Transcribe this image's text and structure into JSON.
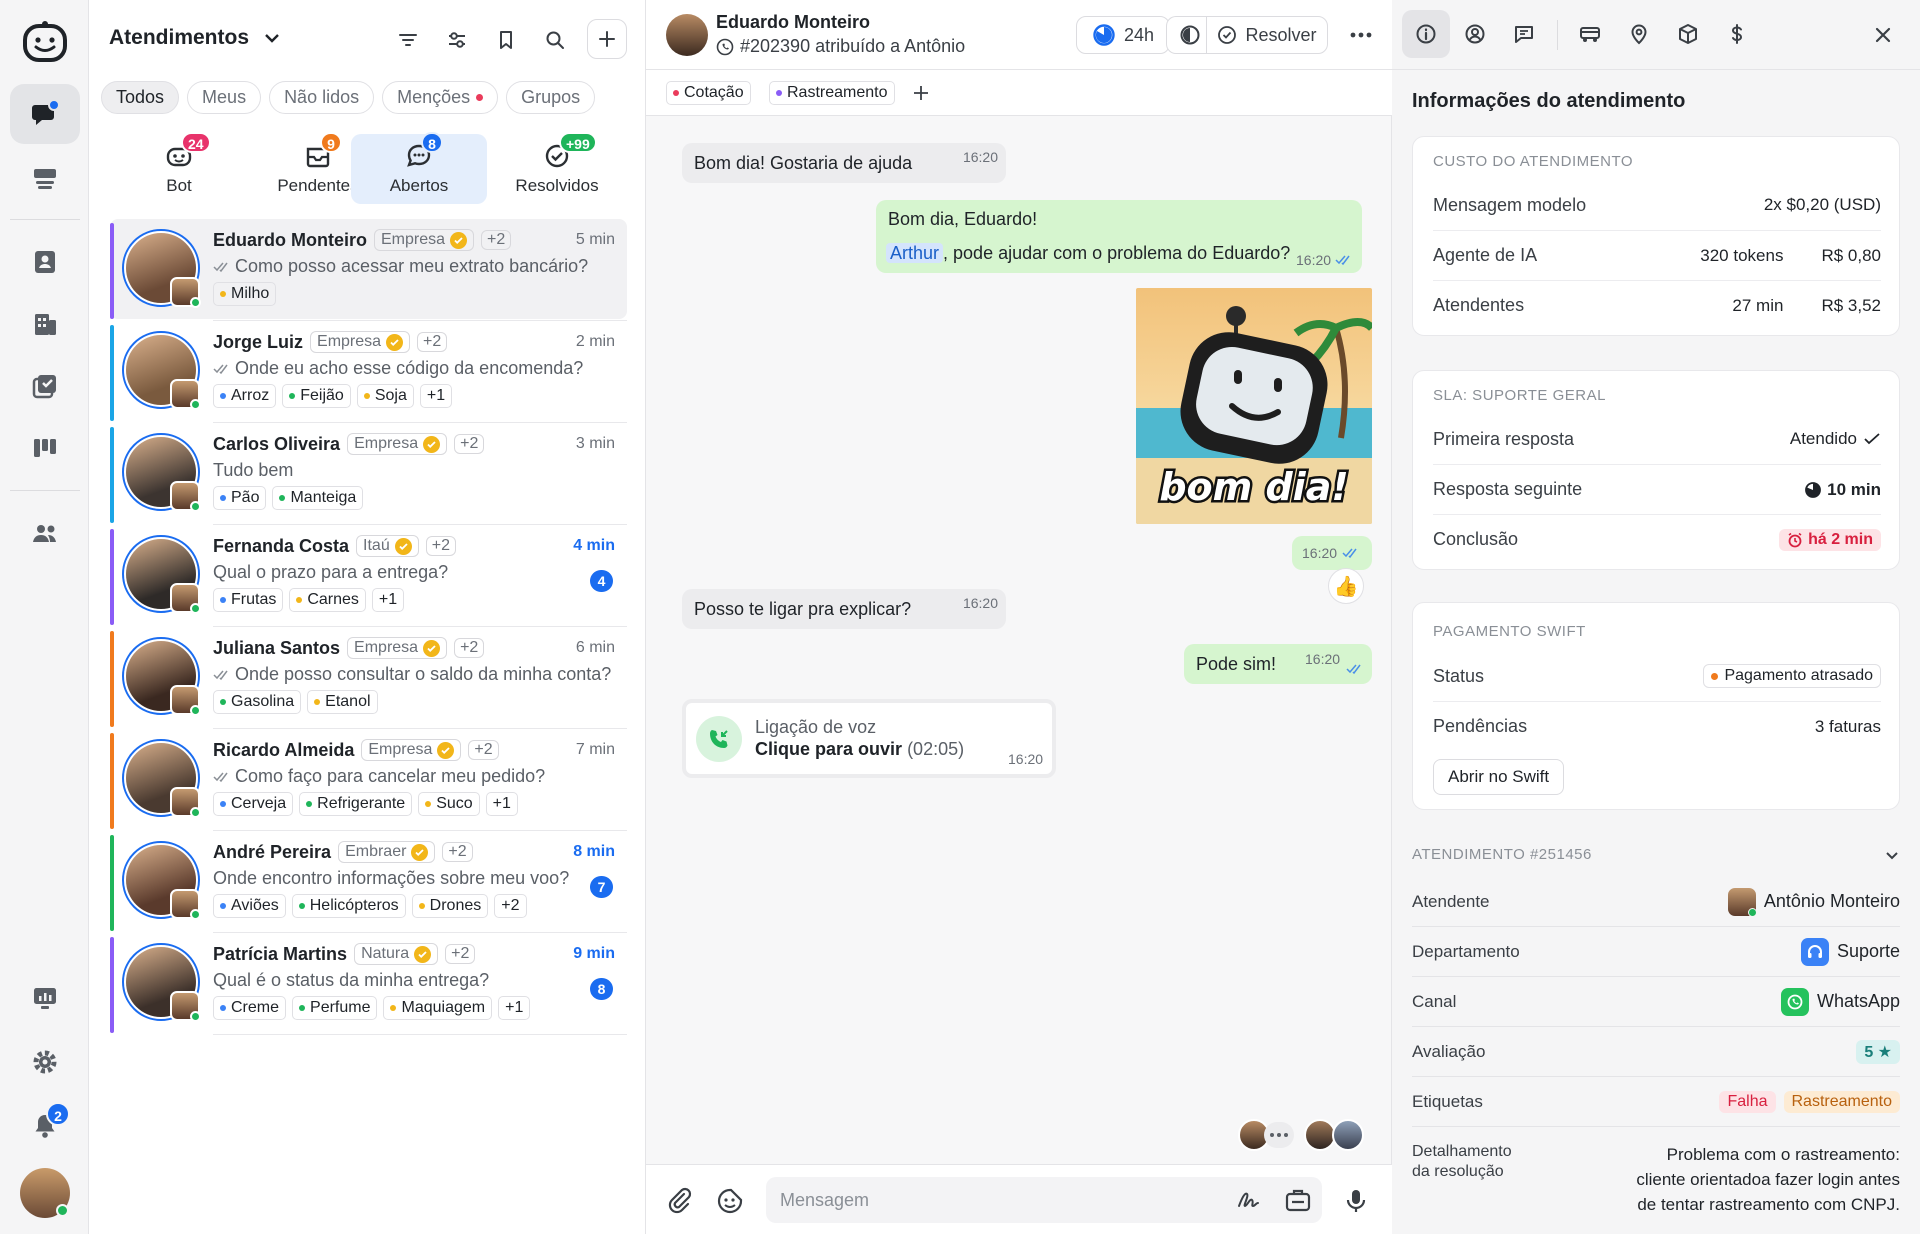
{
  "nav": {
    "notifications_badge": "2"
  },
  "list": {
    "title": "Atendimentos",
    "filters": [
      {
        "label": "Todos",
        "active": true
      },
      {
        "label": "Meus"
      },
      {
        "label": "Não lidos"
      },
      {
        "label": "Menções"
      },
      {
        "label": "Grupos"
      }
    ],
    "status_tabs": [
      {
        "label": "Bot",
        "count": "24",
        "badge_color": "#e8336b"
      },
      {
        "label": "Pendentes",
        "count": "9",
        "badge_color": "#f07a1d"
      },
      {
        "label": "Abertos",
        "count": "8",
        "badge_color": "#1a6cf0"
      },
      {
        "label": "Resolvidos",
        "count": "+99",
        "badge_color": "#1fb55a"
      }
    ],
    "conversations": [
      {
        "name": "Eduardo Monteiro",
        "company": "Empresa",
        "extra": "+2",
        "time": "5 min",
        "message": "Como posso acessar meu extrato bancário?",
        "read": true,
        "unread": "",
        "bar": "#8a5cf6",
        "tags": [
          {
            "label": "Milho",
            "color": "#f2b619"
          }
        ],
        "avatar": "#6b4a36",
        "selected": true
      },
      {
        "name": "Jorge Luiz",
        "company": "Empresa",
        "extra": "+2",
        "time": "2 min",
        "message": "Onde eu acho esse código da encomenda?",
        "read": true,
        "unread": "",
        "bar": "#1aa5e6",
        "tags": [
          {
            "label": "Arroz",
            "color": "#3b82f6"
          },
          {
            "label": "Feijão",
            "color": "#1fb55a"
          },
          {
            "label": "Soja",
            "color": "#f2b619"
          },
          {
            "label": "+1",
            "color": ""
          }
        ],
        "avatar": "#7a5a3e"
      },
      {
        "name": "Carlos Oliveira",
        "company": "Empresa",
        "extra": "+2",
        "time": "3 min",
        "message": "Tudo bem",
        "read": false,
        "unread": "",
        "bar": "#1aa5e6",
        "tags": [
          {
            "label": "Pão",
            "color": "#3b82f6"
          },
          {
            "label": "Manteiga",
            "color": "#1fb55a"
          }
        ],
        "avatar": "#3c3430"
      },
      {
        "name": "Fernanda Costa",
        "company": "Itaú",
        "extra": "+2",
        "time": "4 min",
        "message": "Qual o prazo para a entrega?",
        "read": false,
        "unread": "4",
        "bar": "#8a5cf6",
        "tags": [
          {
            "label": "Frutas",
            "color": "#3b82f6"
          },
          {
            "label": "Carnes",
            "color": "#f2b619"
          },
          {
            "label": "+1",
            "color": ""
          }
        ],
        "avatar": "#2e2a28"
      },
      {
        "name": "Juliana Santos",
        "company": "Empresa",
        "extra": "+2",
        "time": "6 min",
        "message": "Onde posso consultar o saldo da minha conta?",
        "read": true,
        "unread": "",
        "bar": "#f07a1d",
        "tags": [
          {
            "label": "Gasolina",
            "color": "#1fb55a"
          },
          {
            "label": "Etanol",
            "color": "#f2b619"
          }
        ],
        "avatar": "#3a2820"
      },
      {
        "name": "Ricardo Almeida",
        "company": "Empresa",
        "extra": "+2",
        "time": "7 min",
        "message": "Como faço para cancelar meu pedido?",
        "read": true,
        "unread": "",
        "bar": "#f07a1d",
        "tags": [
          {
            "label": "Cerveja",
            "color": "#3b82f6"
          },
          {
            "label": "Refrigerante",
            "color": "#1fb55a"
          },
          {
            "label": "Suco",
            "color": "#f2b619"
          },
          {
            "label": "+1",
            "color": ""
          }
        ],
        "avatar": "#4a3a30"
      },
      {
        "name": "André Pereira",
        "company": "Embraer",
        "extra": "+2",
        "time": "8 min",
        "message": "Onde encontro informações sobre meu voo?",
        "read": false,
        "unread": "7",
        "bar": "#1fb55a",
        "tags": [
          {
            "label": "Aviões",
            "color": "#3b82f6"
          },
          {
            "label": "Helicópteros",
            "color": "#1fb55a"
          },
          {
            "label": "Drones",
            "color": "#f2b619"
          },
          {
            "label": "+2",
            "color": ""
          }
        ],
        "avatar": "#5a3a2c"
      },
      {
        "name": "Patrícia Martins",
        "company": "Natura",
        "extra": "+2",
        "time": "9 min",
        "message": "Qual é o status da minha entrega?",
        "read": false,
        "unread": "8",
        "bar": "#8a5cf6",
        "tags": [
          {
            "label": "Creme",
            "color": "#3b82f6"
          },
          {
            "label": "Perfume",
            "color": "#1fb55a"
          },
          {
            "label": "Maquiagem",
            "color": "#f2b619"
          },
          {
            "label": "+1",
            "color": ""
          }
        ],
        "avatar": "#3c302a"
      }
    ]
  },
  "chat": {
    "contact_name": "Eduardo Monteiro",
    "ticket": "#202390 atribuído a Antônio",
    "timer": "24h",
    "resolve_label": "Resolver",
    "tags": [
      {
        "label": "Cotação",
        "color": "#ea3b5b"
      },
      {
        "label": "Rastreamento",
        "color": "#8a5cf6"
      }
    ],
    "messages": {
      "m1": {
        "text": "Bom dia! Gostaria de ajuda",
        "time": "16:20"
      },
      "m2_line1": "Bom dia, Eduardo!",
      "m2_mention": "Arthur",
      "m2_line2": ", pode ajudar com o problema do Eduardo?",
      "m2_time": "16:20",
      "sticker_text": "bom dia!",
      "m3_time": "16:20",
      "reaction": "👍",
      "m4": {
        "text": "Posso te ligar pra explicar?",
        "time": "16:20"
      },
      "m5": {
        "text": "Pode sim!",
        "time": "16:20"
      },
      "call_title": "Ligação de voz",
      "call_action": "Clique para ouvir",
      "call_duration": "(02:05)",
      "call_time": "16:20"
    },
    "composer_placeholder": "Mensagem"
  },
  "info": {
    "title": "Informações do atendimento",
    "cost": {
      "header": "CUSTO DO ATENDIMENTO",
      "rows": [
        {
          "label": "Mensagem modelo",
          "value1": "",
          "value2": "2x $0,20 (USD)"
        },
        {
          "label": "Agente de IA",
          "value1": "320 tokens",
          "value2": "R$ 0,80"
        },
        {
          "label": "Atendentes",
          "value1": "27 min",
          "value2": "R$ 3,52"
        }
      ]
    },
    "sla": {
      "header": "SLA: SUPORTE GERAL",
      "first_label": "Primeira resposta",
      "first_value": "Atendido",
      "next_label": "Resposta seguinte",
      "next_value": "10 min",
      "done_label": "Conclusão",
      "done_value": "há 2 min"
    },
    "swift": {
      "header": "PAGAMENTO SWIFT",
      "status_label": "Status",
      "status_value": "Pagamento atrasado",
      "pending_label": "Pendências",
      "pending_value": "3 faturas",
      "button": "Abrir no Swift"
    },
    "ticket": {
      "header": "ATENDIMENTO #251456",
      "agent_label": "Atendente",
      "agent_value": "Antônio Monteiro",
      "dept_label": "Departamento",
      "dept_value": "Suporte",
      "channel_label": "Canal",
      "channel_value": "WhatsApp",
      "rating_label": "Avaliação",
      "rating_value": "5 ★",
      "tags_label": "Etiquetas",
      "tag1": "Falha",
      "tag2": "Rastreamento",
      "detail_label_1": "Detalhamento",
      "detail_label_2": "da resolução",
      "detail_value": "Problema com o rastreamento: cliente orientadoa fazer login antes de tentar rastreamento com CNPJ."
    }
  }
}
